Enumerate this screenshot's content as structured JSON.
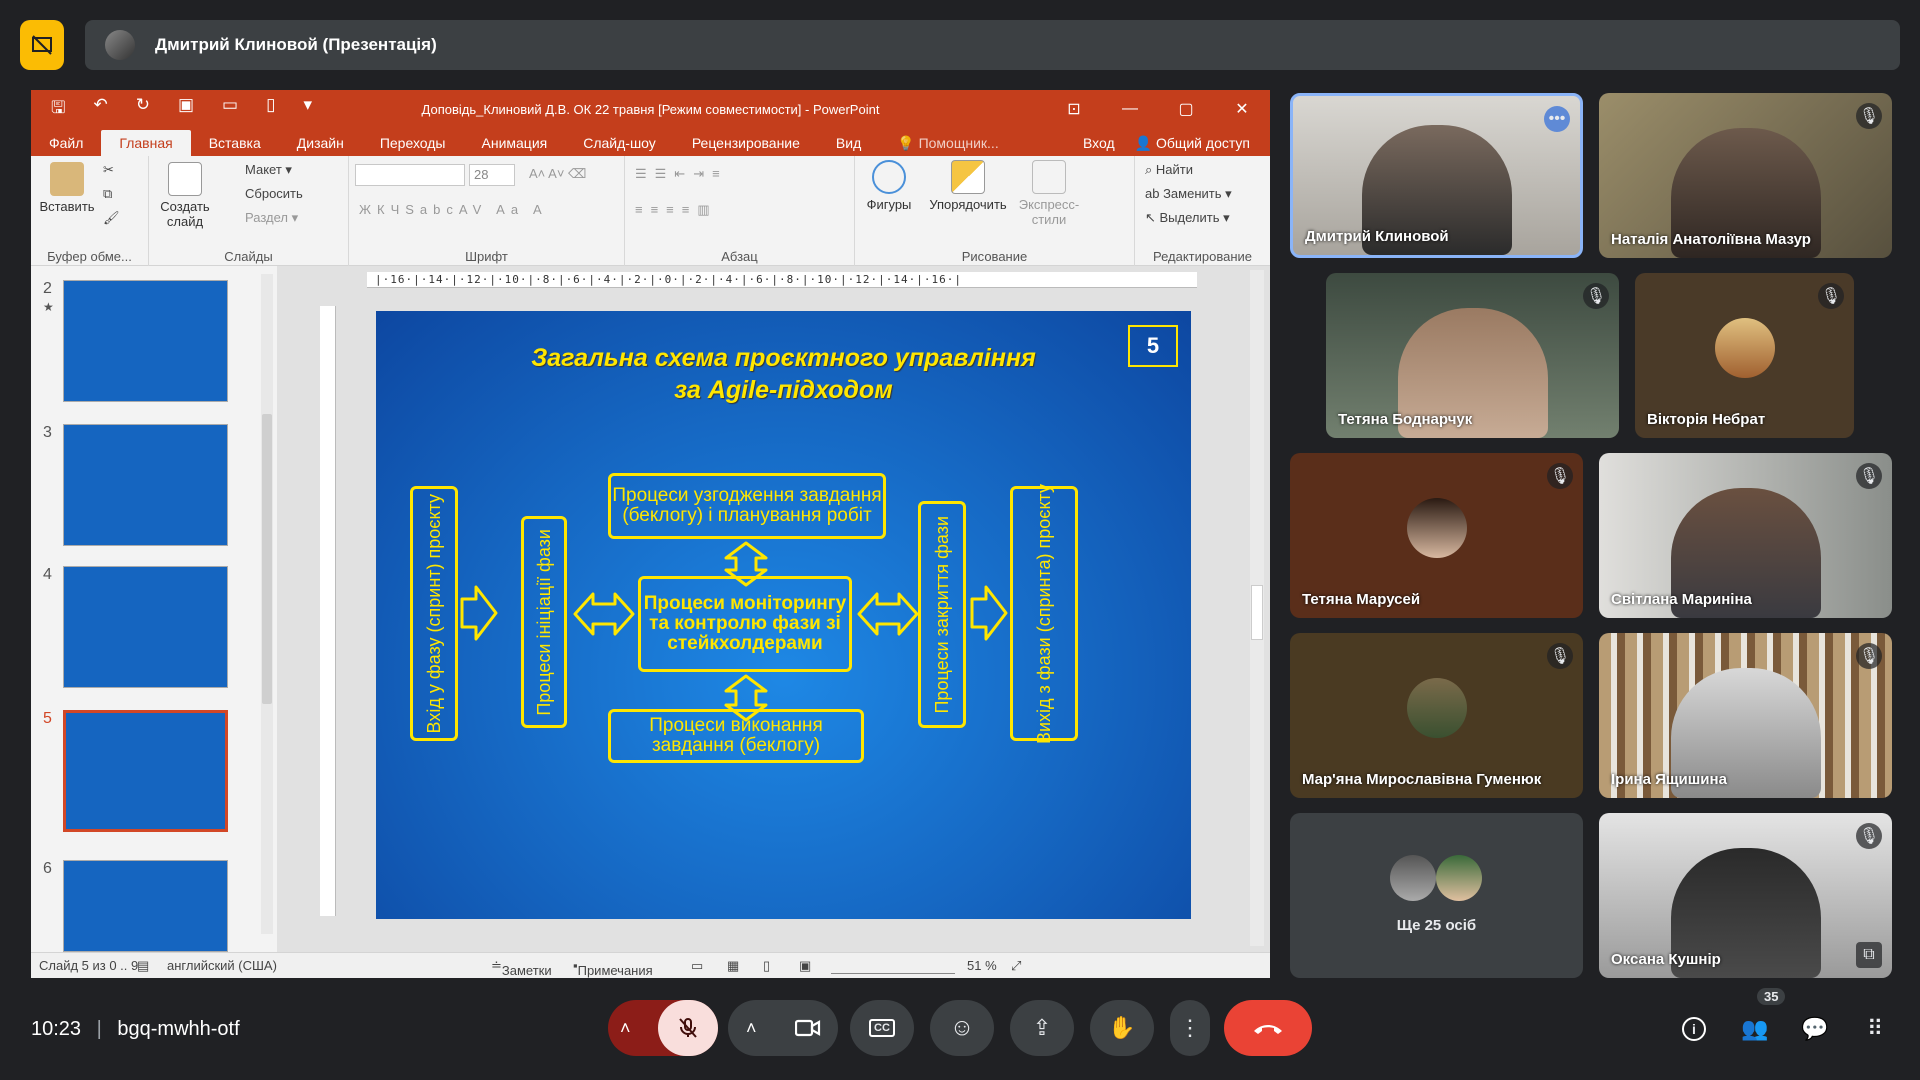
{
  "topbar": {
    "presenter_label": "Дмитрий Клиновой (Презентація)"
  },
  "powerpoint": {
    "title": "Доповідь_Клиновий Д.В. ОК 22 травня [Режим совместимости] - PowerPoint",
    "tabs": [
      "Файл",
      "Главная",
      "Вставка",
      "Дизайн",
      "Переходы",
      "Анимация",
      "Слайд-шоу",
      "Рецензирование",
      "Вид"
    ],
    "helper": "Помощник...",
    "signin": "Вход",
    "share": "Общий доступ",
    "ribbon": {
      "paste": "Вставить",
      "clipboard_group": "Буфер обме...",
      "new_slide": "Создать слайд",
      "layout": "Макет",
      "reset": "Сбросить",
      "section": "Раздел",
      "slides_group": "Слайды",
      "font_size": "28",
      "font_group": "Шрифт",
      "paragraph_group": "Абзац",
      "shapes": "Фигуры",
      "arrange": "Упорядочить",
      "quick_styles": "Экспресс-стили",
      "drawing_group": "Рисование",
      "find": "Найти",
      "replace": "Заменить",
      "select": "Выделить",
      "editing_group": "Редактирование"
    },
    "thumbnails": [
      {
        "num": "2",
        "star": "★"
      },
      {
        "num": "3"
      },
      {
        "num": "4"
      },
      {
        "num": "5",
        "selected": true
      },
      {
        "num": "6"
      }
    ],
    "ruler": "|·16·|·14·|·12·|·10·|·8·|·6·|·4·|·2·|·0·|·2·|·4·|·6·|·8·|·10·|·12·|·14·|·16·|",
    "slide": {
      "title_line1": "Загальна схема проєктного управління",
      "title_line2": "за Agile-підходом",
      "number": "5",
      "entry": "Вхід у фазу (спринт) проєкту",
      "initiation": "Процеси ініціації фази",
      "coordination": "Процеси узгодження завдання (беклогу) і планування робіт",
      "monitoring": "Процеси моніторингу та контролю фази зі стейкхолдерами",
      "execution": "Процеси виконання завдання (беклогу)",
      "closing": "Процеси закриття фази",
      "exit": "Вихід з фази (спринта) проєкту"
    },
    "status": {
      "slide": "Слайд 5 из 0 .. 9",
      "language": "английский (США)",
      "notes": "Заметки",
      "comments": "Примечания",
      "zoom": "51 %"
    }
  },
  "participants": [
    {
      "name": "Дмитрий Клиновой",
      "muted": false,
      "speaking": true
    },
    {
      "name": "Наталія Анатоліївна Мазур",
      "muted": true
    },
    {
      "name": "Тетяна Боднарчук",
      "muted": true
    },
    {
      "name": "Вікторія Небрат",
      "muted": true
    },
    {
      "name": "Тетяна Марусей",
      "muted": true
    },
    {
      "name": "Світлана Мариніна",
      "muted": true
    },
    {
      "name": "Мар'яна Мирославівна Гуменюк",
      "muted": true
    },
    {
      "name": "Ірина Ящишина",
      "muted": true
    },
    {
      "name": "Ще 25 осіб"
    },
    {
      "name": "Оксана Кушнір",
      "muted": true
    }
  ],
  "bottombar": {
    "time": "10:23",
    "meeting_code": "bgq-mwhh-otf",
    "participant_count": "35"
  },
  "colors": {
    "meet_bg": "#202124",
    "pp_accent": "#c43e1c",
    "slide_yellow": "#ffe600",
    "end_call": "#ea4335",
    "mic_off_bg": "#f9dedc"
  }
}
